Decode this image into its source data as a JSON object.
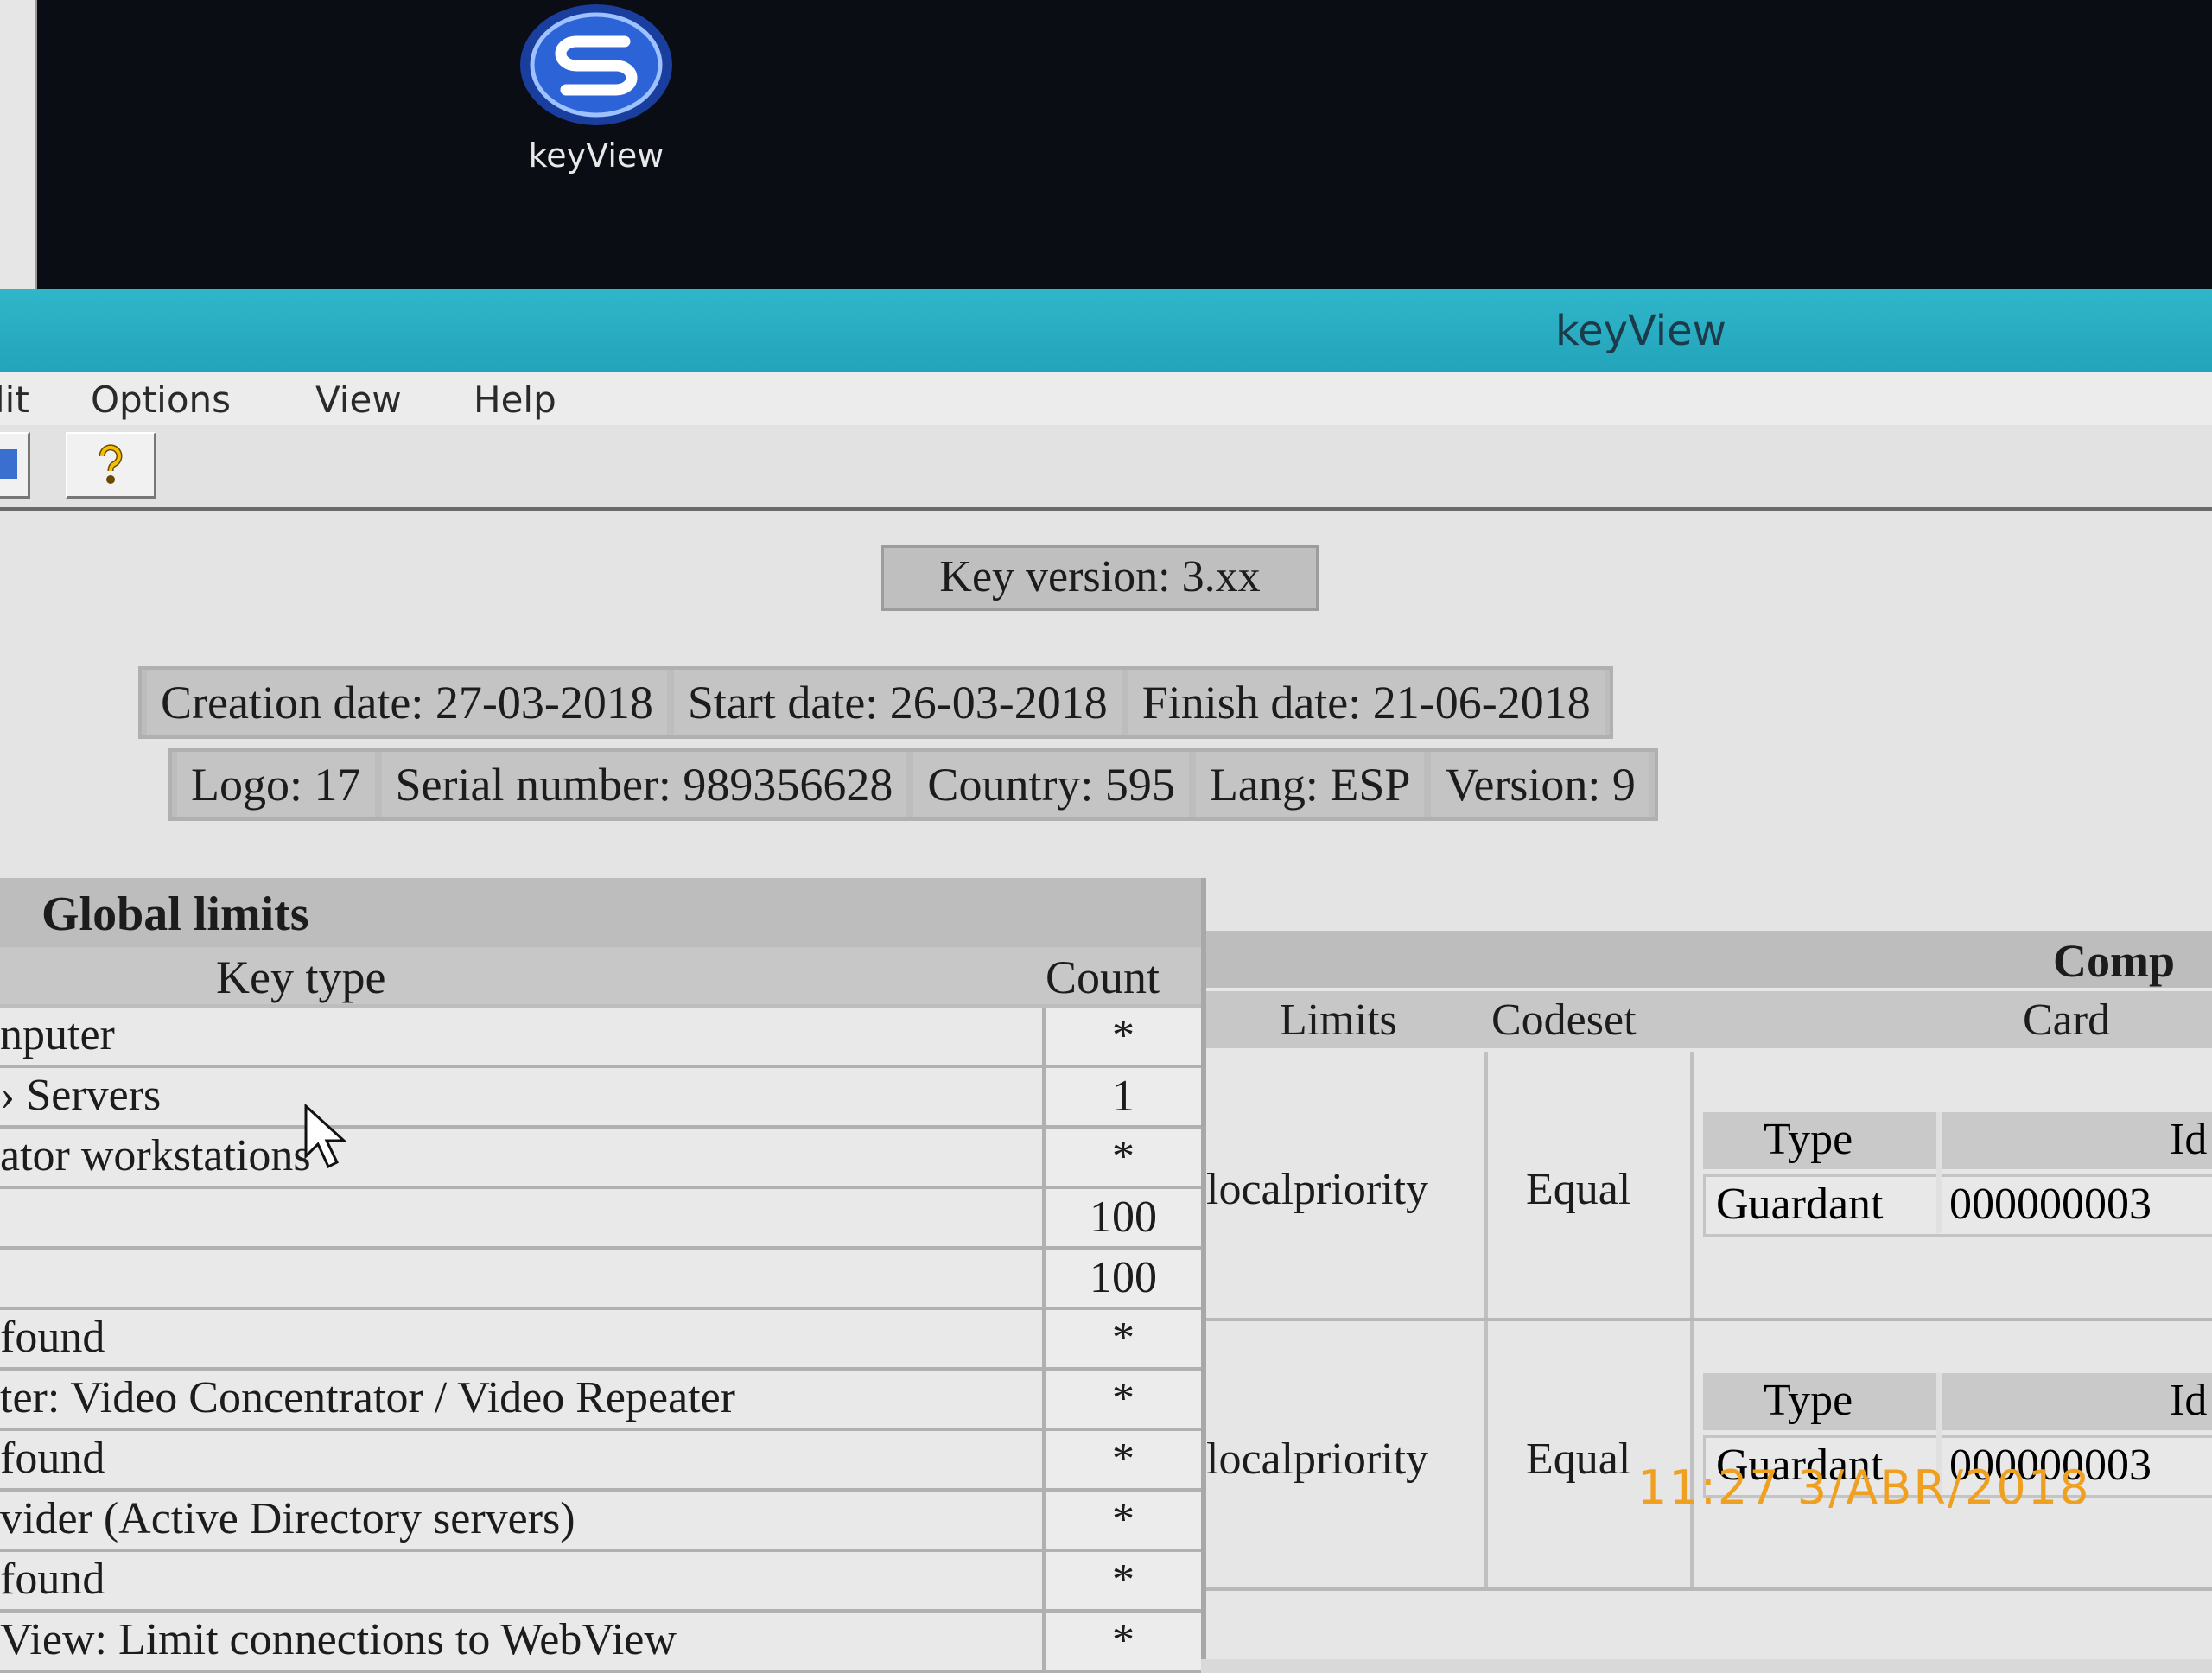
{
  "desktop": {
    "icon": {
      "name": "keyview-logo-icon",
      "label": "keyView"
    }
  },
  "window": {
    "title": "keyView"
  },
  "menu": {
    "items": [
      "lit",
      "Options",
      "View",
      "Help"
    ]
  },
  "toolbar": {
    "buttons": [
      "open-icon",
      "help-icon"
    ]
  },
  "key_version": "Key version: 3.xx",
  "dates": {
    "creation": "Creation date: 27-03-2018",
    "start": "Start date: 26-03-2018",
    "finish": "Finish date: 21-06-2018"
  },
  "details": {
    "logo": "Logo: 17",
    "serial": "Serial number: 989356628",
    "country": "Country: 595",
    "lang": "Lang: ESP",
    "version": "Version: 9"
  },
  "global_limits": {
    "title": "Global limits",
    "col_key_type": "Key type",
    "col_count": "Count",
    "rows": [
      {
        "name": "nputer",
        "count": "*"
      },
      {
        "name": "› Servers",
        "count": "1"
      },
      {
        "name": "ator workstations",
        "count": "*"
      },
      {
        "name": "",
        "count": "100"
      },
      {
        "name": "",
        "count": "100"
      },
      {
        "name": "found",
        "count": "*"
      },
      {
        "name": "ter: Video Concentrator / Video Repeater",
        "count": "*"
      },
      {
        "name": "found",
        "count": "*"
      },
      {
        "name": "vider (Active Directory servers)",
        "count": "*"
      },
      {
        "name": "found",
        "count": "*"
      },
      {
        "name": "View: Limit connections to WebView",
        "count": "*"
      }
    ]
  },
  "components": {
    "title": "Comp",
    "col_limits": "Limits",
    "col_codeset": "Codeset",
    "col_card": "Card",
    "blocks": [
      {
        "limits": "localpriority",
        "codeset": "Equal",
        "card_type_header": "Type",
        "card_id_header": "Id",
        "card_type": "Guardant",
        "card_id": "000000003"
      },
      {
        "limits": "localpriority",
        "codeset": "Equal",
        "card_type_header": "Type",
        "card_id_header": "Id",
        "card_type": "Guardant",
        "card_id": "000000003"
      }
    ]
  },
  "photo_timestamp": "11:27  3/ABR/2018"
}
